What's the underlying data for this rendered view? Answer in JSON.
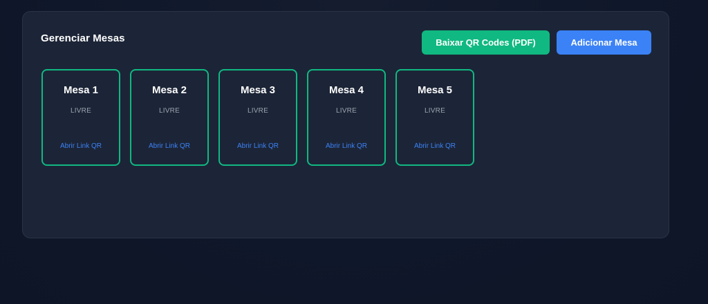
{
  "panel": {
    "title": "Gerenciar Mesas",
    "download_button": "Baixar QR Codes (PDF)",
    "add_button": "Adicionar Mesa"
  },
  "tables": [
    {
      "name": "Mesa 1",
      "status": "LIVRE",
      "link": "Abrir Link QR"
    },
    {
      "name": "Mesa 2",
      "status": "LIVRE",
      "link": "Abrir Link QR"
    },
    {
      "name": "Mesa 3",
      "status": "LIVRE",
      "link": "Abrir Link QR"
    },
    {
      "name": "Mesa 4",
      "status": "LIVRE",
      "link": "Abrir Link QR"
    },
    {
      "name": "Mesa 5",
      "status": "LIVRE",
      "link": "Abrir Link QR"
    }
  ],
  "colors": {
    "background": "#0f172a",
    "panel": "#1c2537",
    "accent_green": "#10b981",
    "accent_blue": "#3b82f6",
    "status_text": "#9ca3af"
  }
}
